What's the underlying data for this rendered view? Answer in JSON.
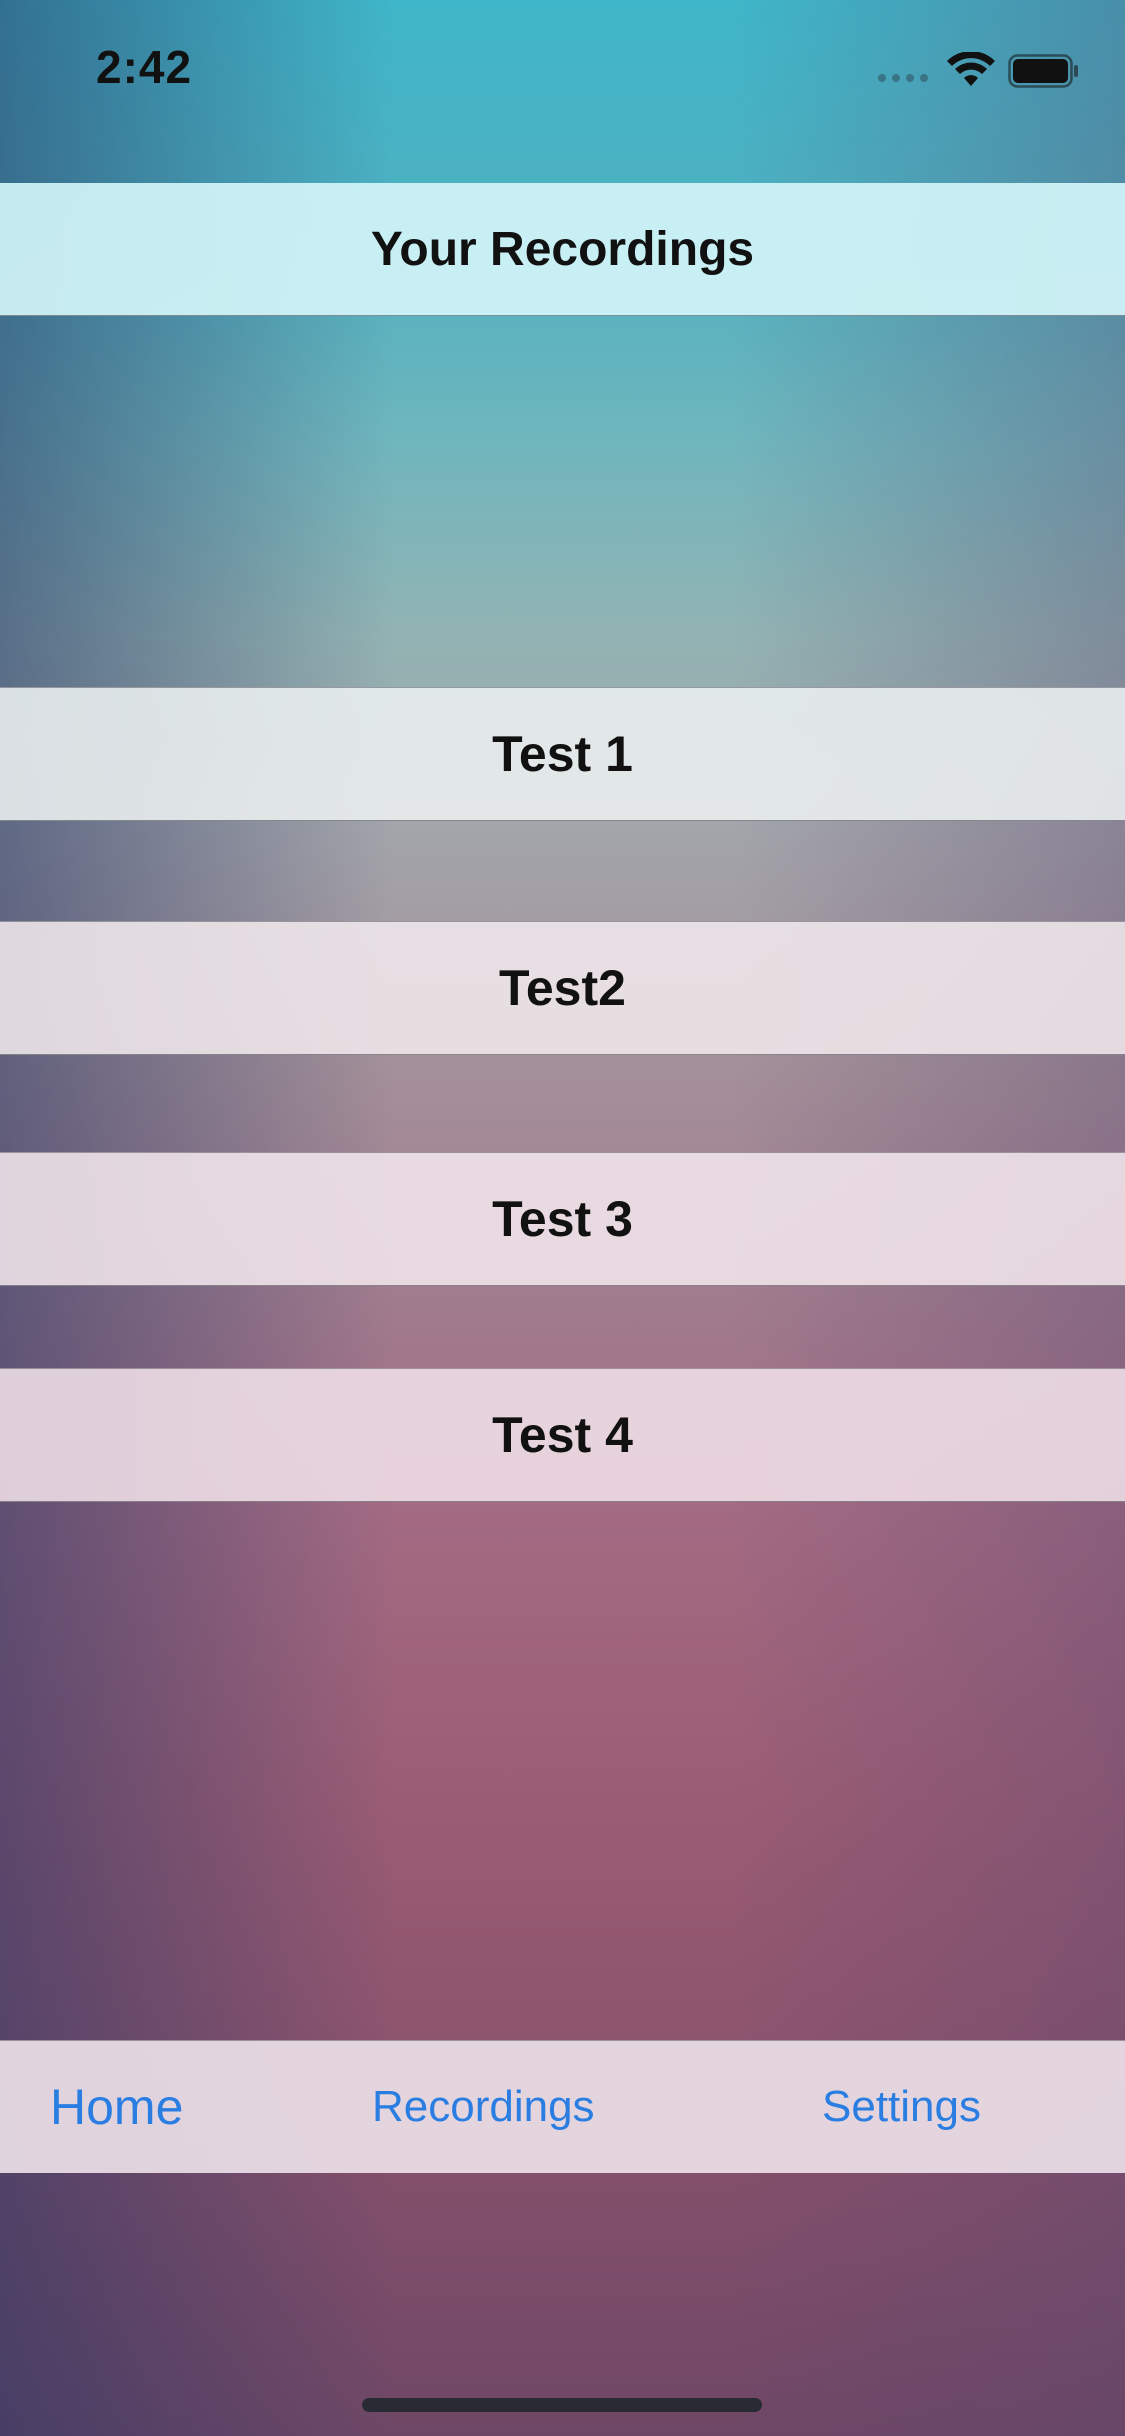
{
  "status_bar": {
    "time": "2:42"
  },
  "header": {
    "title": "Your Recordings"
  },
  "recordings": [
    {
      "label": "Test 1"
    },
    {
      "label": "Test2"
    },
    {
      "label": "Test 3"
    },
    {
      "label": "Test 4"
    }
  ],
  "tab_bar": {
    "items": [
      {
        "label": "Home"
      },
      {
        "label": "Recordings"
      },
      {
        "label": "Settings"
      }
    ],
    "accent_color": "#2a7de1"
  },
  "icons": [
    "wifi-icon",
    "battery-icon",
    "cellular-signal-icon"
  ]
}
